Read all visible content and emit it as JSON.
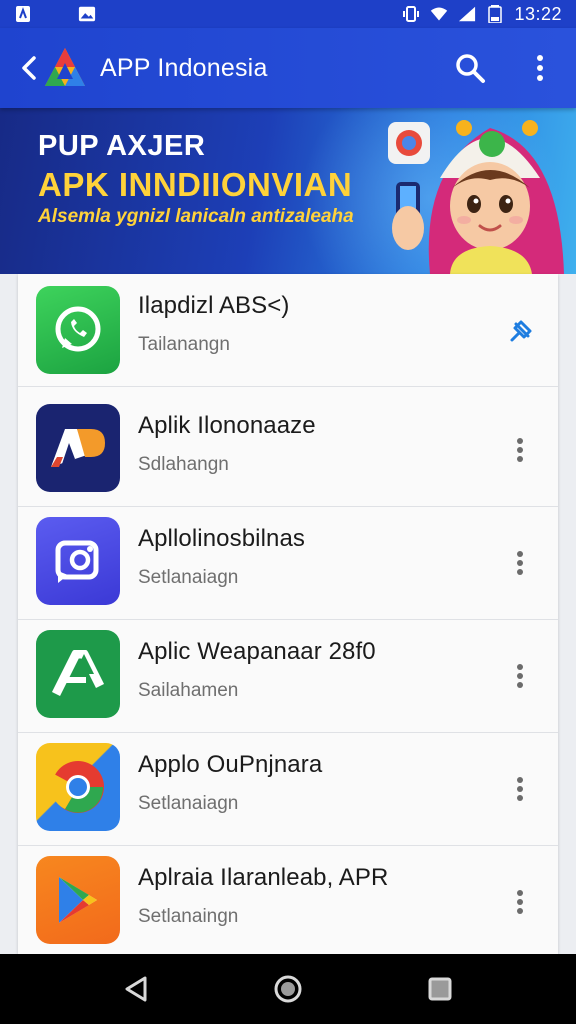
{
  "status_bar": {
    "time": "13:22",
    "icons": [
      "notification-icon",
      "image-icon",
      "vibrate-icon",
      "wifi-icon",
      "signal-icon",
      "battery-icon"
    ]
  },
  "app_bar": {
    "title": "APP Indonesia",
    "back_icon": "chevron-left-icon",
    "search_icon": "search-icon",
    "menu_icon": "more-vertical-icon"
  },
  "banner": {
    "line1": "PUP AXJER",
    "line2": "APK INNDIIONVIAN",
    "line3": "Alsemla ygnizl lanicaln antizaleaha"
  },
  "apps": [
    {
      "title": "Ilapdizl ABS<)",
      "subtitle": "Tailanangn",
      "icon": "whatsapp-icon",
      "action": "pin-icon"
    },
    {
      "title": "Aplik Ilononaaze",
      "subtitle": "Sdlahangn",
      "icon": "ap-logo-icon",
      "action": "more-vertical-icon"
    },
    {
      "title": "Apllolinosbilnas",
      "subtitle": "Setlanaiagn",
      "icon": "chat-camera-icon",
      "action": "more-vertical-icon"
    },
    {
      "title": "Aplic Weapanaar 28f0",
      "subtitle": "Sailahamen",
      "icon": "a-logo-icon",
      "action": "more-vertical-icon"
    },
    {
      "title": "Applo OuPnjnara",
      "subtitle": "Setlanaiagn",
      "icon": "chrome-icon",
      "action": "more-vertical-icon"
    },
    {
      "title": "Aplraia Ilaranleab, APR",
      "subtitle": "Setlanaingn",
      "icon": "play-store-icon",
      "action": "more-vertical-icon"
    }
  ],
  "colors": {
    "primary": "#1f44cf",
    "banner_yellow": "#ffd23a",
    "list_bg": "#fafafa"
  },
  "nav_bar": {
    "icons": [
      "back-triangle-icon",
      "home-circle-icon",
      "recents-square-icon"
    ]
  }
}
